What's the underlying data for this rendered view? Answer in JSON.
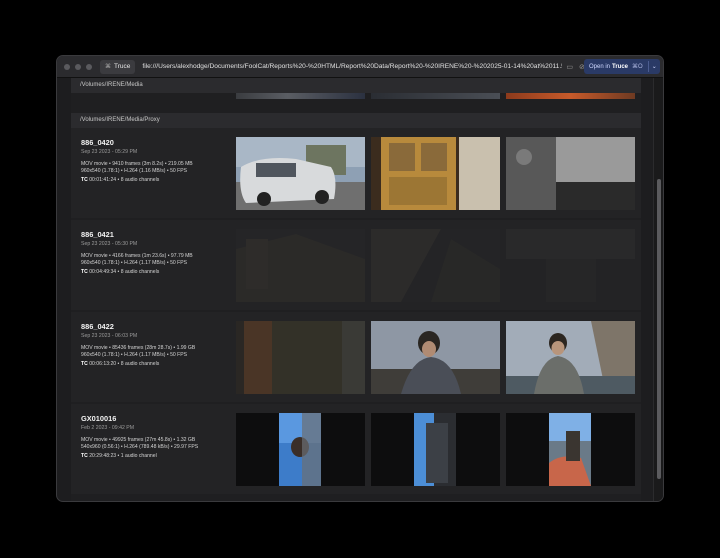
{
  "browser": {
    "tab_label": "Truce",
    "url": "file:///Users/alexhodge/Documents/FoolCat/Reports%20-%20HTML/Report%20Data/Report%20-%20IRENE%20-%202025-01-14%20at%2011.50....",
    "open_in_label": "Open in",
    "open_in_app": "Truce",
    "open_in_shortcut": "⌘O"
  },
  "sections": [
    {
      "path": "/Volumes/IRENE/Media"
    },
    {
      "path": "/Volumes/IRENE/Media/Proxy"
    }
  ],
  "clips": [
    {
      "name": "886_0420",
      "date": "Sep 23 2023 - 05:29 PM",
      "line1": "MOV movie • 9410 frames (3m 8.2s) • 219.05 MB",
      "line2": "960x540 (1.78:1) • H.264 (1.16 MB/s) • 50 FPS",
      "tc_label": "TC",
      "tc": "00:01:41:24 • 8 audio channels"
    },
    {
      "name": "886_0421",
      "date": "Sep 23 2023 - 05:30 PM",
      "line1": "MOV movie • 4166 frames (1m 23.6s) • 97.79 MB",
      "line2": "960x540 (1.78:1) • H.264 (1.17 MB/s) • 50 FPS",
      "tc_label": "TC",
      "tc": "00:04:49:34 • 8 audio channels"
    },
    {
      "name": "886_0422",
      "date": "Sep 23 2023 - 06:03 PM",
      "line1": "MOV movie • 85436 frames (28m 28.7s) • 1.99 GB",
      "line2": "960x540 (1.78:1) • H.264 (1.17 MB/s) • 50 FPS",
      "tc_label": "TC",
      "tc": "00:06:13:20 • 8 audio channels"
    },
    {
      "name": "GX010016",
      "date": "Feb 2 2023 - 09:42 PM",
      "line1": "MOV movie • 49925 frames (27m 45.8s) • 1.32 GB",
      "line2": "540x960 (0.56:1) • H.264 (789.48 kB/s) • 29.97 FPS",
      "tc_label": "TC",
      "tc": "20:29:48:23 • 1 audio channel"
    }
  ],
  "colors": {
    "window_bg": "#1d1d1f",
    "clip_bg": "#232325",
    "path_bg": "#2b2b2e",
    "accent_button": "#2a3a66"
  }
}
